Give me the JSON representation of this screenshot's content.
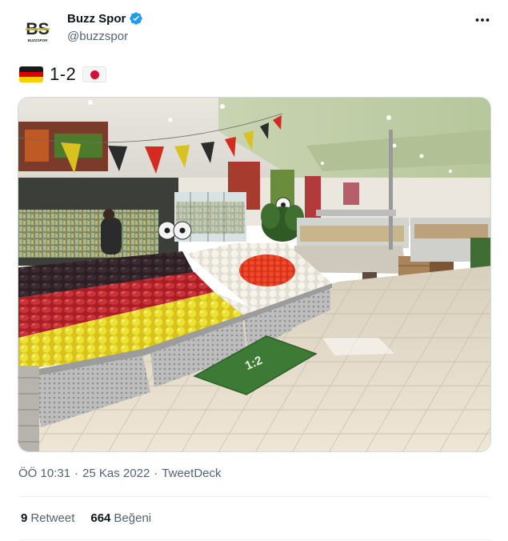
{
  "user": {
    "display_name": "Buzz Spor",
    "handle": "@buzzspor",
    "avatar_text": "BS",
    "avatar_subtext": "BUZZSPOR",
    "verified": true
  },
  "tweet": {
    "score": "1-2",
    "flag_left": "Germany flag",
    "flag_right": "Japan flag"
  },
  "media": {
    "floor_mat_text": "1:2"
  },
  "meta": {
    "time": "ÖÖ 10:31",
    "date": "25 Kas 2022",
    "separator": "·",
    "source": "TweetDeck"
  },
  "stats": {
    "retweets_count": "9",
    "retweets_label": "Retweet",
    "likes_count": "664",
    "likes_label": "Beğeni"
  },
  "colors": {
    "verified_blue": "#1d9bf0",
    "text_secondary": "#536471",
    "text_primary": "#0f1419"
  }
}
